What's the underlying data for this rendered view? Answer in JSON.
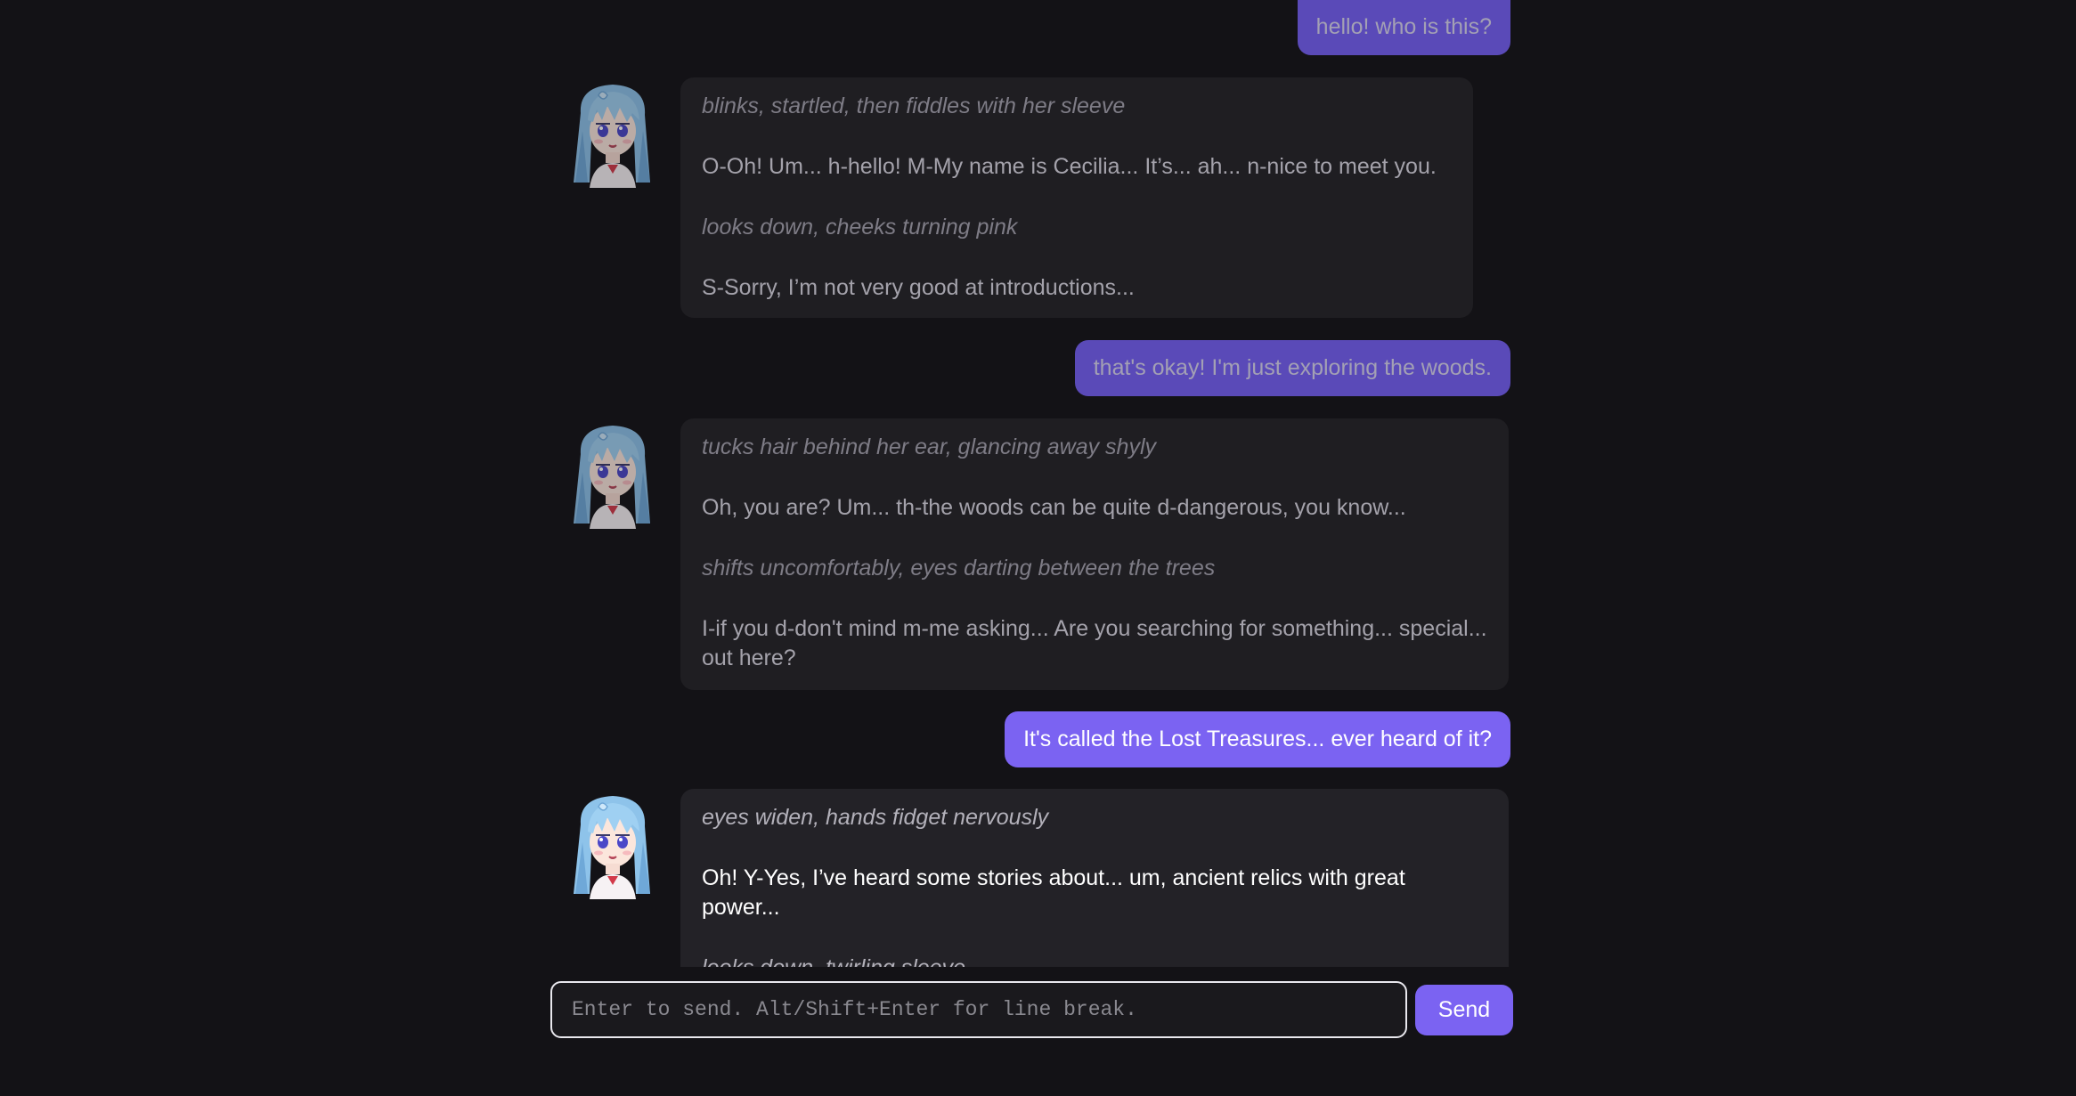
{
  "conversation": [
    {
      "role": "user",
      "text": "hello! who is this?"
    },
    {
      "role": "character",
      "lines": [
        {
          "kind": "action",
          "text": "blinks, startled, then fiddles with her sleeve"
        },
        {
          "kind": "speech",
          "text": "O-Oh! Um... h-hello! M-My name is Cecilia... It’s... ah... n-nice to meet you."
        },
        {
          "kind": "action",
          "text": "looks down, cheeks turning pink"
        },
        {
          "kind": "speech",
          "text": "S-Sorry, I’m not very good at introductions..."
        }
      ]
    },
    {
      "role": "user",
      "text": "that's okay! I'm just exploring the woods."
    },
    {
      "role": "character",
      "lines": [
        {
          "kind": "action",
          "text": "tucks hair behind her ear, glancing away shyly"
        },
        {
          "kind": "speech",
          "text": "Oh, you are? Um... th-the woods can be quite d-dangerous, you know..."
        },
        {
          "kind": "action",
          "text": "shifts uncomfortably, eyes darting between the trees"
        },
        {
          "kind": "speech",
          "text": "I-if you d-don't mind m-me asking... Are you searching for something... special... out here?"
        }
      ]
    },
    {
      "role": "user",
      "text": "It's called the Lost Treasures... ever heard of it?"
    },
    {
      "role": "character",
      "lines": [
        {
          "kind": "action",
          "text": "eyes widen, hands fidget nervously"
        },
        {
          "kind": "speech",
          "text": "Oh! Y-Yes, I’ve heard some stories about... um, ancient relics with great power..."
        },
        {
          "kind": "action",
          "text": "looks down, twirling sleeve"
        }
      ]
    }
  ],
  "composer": {
    "placeholder": "Enter to send. Alt/Shift+Enter for line break.",
    "value": "",
    "send_label": "Send"
  },
  "colors": {
    "background": "#131216",
    "accent": "#7b63f2",
    "character_bubble": "#1f1e22"
  }
}
